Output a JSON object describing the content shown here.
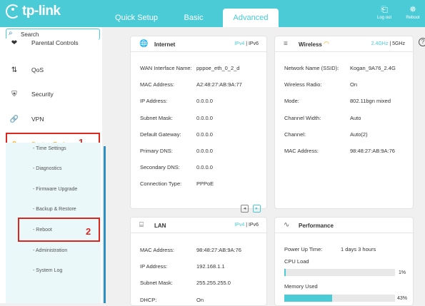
{
  "brand": {
    "name": "tp-link"
  },
  "tabs": {
    "quick": "Quick Setup",
    "basic": "Basic",
    "advanced": "Advanced"
  },
  "top": {
    "logout": "Log out",
    "reboot": "Reboot"
  },
  "search": {
    "placeholder": "Search"
  },
  "nav": {
    "parental": "Parental Controls",
    "qos": "QoS",
    "security": "Security",
    "vpn": "VPN",
    "system_tools": "System Tools"
  },
  "sub": [
    "- Time Settings",
    "- Diagnostics",
    "- Firmware Upgrade",
    "- Backup & Restore",
    "- Reboot",
    "- Administration",
    "- System Log"
  ],
  "markers": {
    "one": "1",
    "two": "2"
  },
  "internet": {
    "title": "Internet",
    "ipv4": "IPv4",
    "sep": "|",
    "ipv6": "IPv6",
    "rows": [
      [
        "WAN Interface Name:",
        "pppoe_eth_0_2_d"
      ],
      [
        "MAC Address:",
        "A2:48:27:AB:9A:77"
      ],
      [
        "IP Address:",
        "0.0.0.0"
      ],
      [
        "Subnet Mask:",
        "0.0.0.0"
      ],
      [
        "Default Gateway:",
        "0.0.0.0"
      ],
      [
        "Primary DNS:",
        "0.0.0.0"
      ],
      [
        "Secondary DNS:",
        "0.0.0.0"
      ],
      [
        "Connection Type:",
        "PPPoE"
      ]
    ]
  },
  "wireless": {
    "title": "Wireless",
    "band24": "2.4GHz",
    "sep": "|",
    "band5": "5GHz",
    "rows": [
      [
        "Network Name (SSID):",
        "Kogan_9A76_2.4G"
      ],
      [
        "Wireless Radio:",
        "On"
      ],
      [
        "Mode:",
        "802.11bgn mixed"
      ],
      [
        "Channel Width:",
        "Auto"
      ],
      [
        "Channel:",
        "Auto(2)"
      ],
      [
        "MAC Address:",
        "98:48:27:AB:9A:76"
      ]
    ]
  },
  "lan": {
    "title": "LAN",
    "ipv4": "IPv4",
    "sep": "|",
    "ipv6": "IPv6",
    "rows": [
      [
        "MAC Address:",
        "98:48:27:AB:9A:76"
      ],
      [
        "IP Address:",
        "192.168.1.1"
      ],
      [
        "Subnet Mask:",
        "255.255.255.0"
      ],
      [
        "DHCP:",
        "On"
      ]
    ]
  },
  "performance": {
    "title": "Performance",
    "uptime_label": "Power Up Time:",
    "uptime": "1 days 3 hours",
    "cpu_label": "CPU Load",
    "cpu_pct": "1%",
    "cpu": 0.01,
    "mem_label": "Memory Used",
    "mem_pct": "43%",
    "mem": 0.43
  },
  "colors": {
    "accent": "#4acbd6",
    "annotation": "#d9281f",
    "active_nav": "#f0a30a"
  }
}
